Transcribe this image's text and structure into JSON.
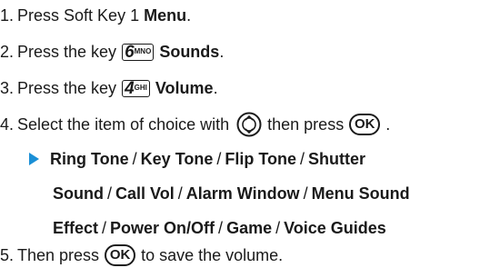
{
  "steps": [
    {
      "num": "1.",
      "pre": "Press Soft Key 1",
      "bold": "Menu",
      "post": "."
    },
    {
      "num": "2.",
      "pre": "Press the key",
      "key_main": "6",
      "key_sub": "MNO",
      "bold": "Sounds",
      "post": "."
    },
    {
      "num": "3.",
      "pre": "Press the key",
      "key_main": "4",
      "key_sub": "GHI",
      "bold": "Volume",
      "post": "."
    },
    {
      "num": "4.",
      "pre": "Select the item of choice with",
      "mid": "then press",
      "ok": "OK",
      "post": "."
    },
    {
      "num": "5.",
      "pre": "Then press",
      "ok": "OK",
      "post": "to save the volume."
    }
  ],
  "options": {
    "sep": "/",
    "items": [
      "Ring Tone",
      "Key Tone",
      "Flip Tone",
      "Shutter Sound",
      "Call Vol",
      "Alarm Window",
      "Menu Sound Effect",
      "Power On/Off",
      "Game",
      "Voice Guides"
    ],
    "line1": [
      "Ring Tone",
      "Key Tone",
      "Flip Tone",
      "Shutter"
    ],
    "line2": [
      "Sound",
      "Call Vol",
      "Alarm Window",
      "Menu Sound"
    ],
    "line3": [
      "Effect",
      "Power On/Off",
      "Game",
      "Voice Guides"
    ]
  },
  "colors": {
    "arrow": "#1a8fd6",
    "text": "#1a1a1a"
  },
  "icons": {
    "nav": "navigation-key-icon",
    "ok": "ok-key-icon",
    "arrow": "right-triangle-icon"
  }
}
